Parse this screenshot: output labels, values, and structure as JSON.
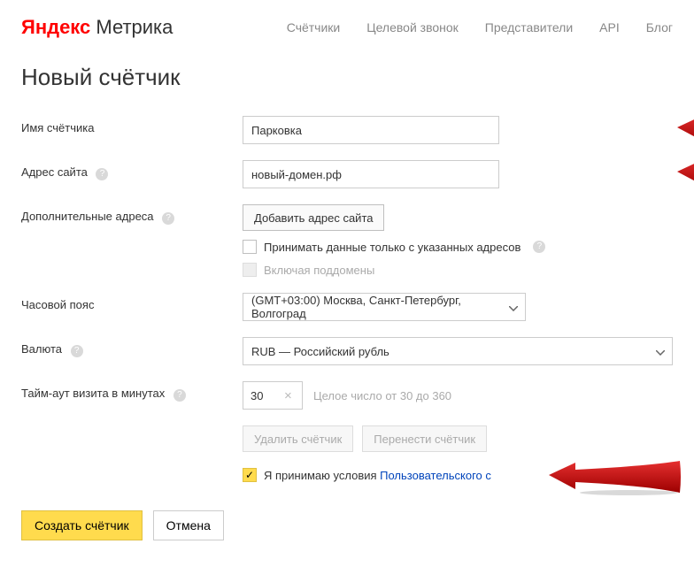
{
  "header": {
    "logo_ya": "Яндекс",
    "logo_metr": " Метрика",
    "nav": [
      "Счётчики",
      "Целевой звонок",
      "Представители",
      "API",
      "Блог"
    ]
  },
  "page_title": "Новый счётчик",
  "labels": {
    "name": "Имя счётчика",
    "site": "Адрес сайта",
    "extra": "Дополнительные адреса",
    "tz": "Часовой пояс",
    "currency": "Валюта",
    "timeout": "Тайм-аут визита в минутах"
  },
  "values": {
    "name": "Парковка",
    "site": "новый-домен.рф",
    "timeout": "30"
  },
  "extra": {
    "add_btn": "Добавить адрес сайта",
    "only_listed": "Принимать данные только с указанных адресов",
    "subdomains": "Включая поддомены"
  },
  "tz_selected": "(GMT+03:00) Москва, Санкт-Петербург, Волгоград",
  "currency_selected": "RUB — Российский рубль",
  "timeout_hint": "Целое число от 30 до 360",
  "actions": {
    "delete": "Удалить счётчик",
    "move": "Перенести счётчик"
  },
  "agree": {
    "prefix": "Я принимаю условия ",
    "link": "Пользовательского с"
  },
  "footer": {
    "create": "Создать счётчик",
    "cancel": "Отмена"
  }
}
